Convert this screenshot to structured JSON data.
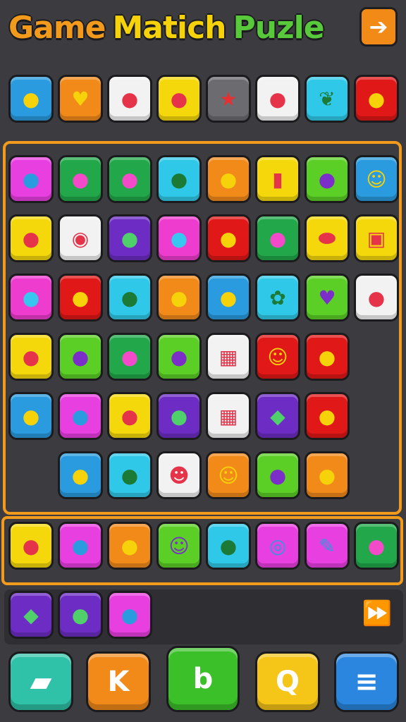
{
  "title": {
    "words": [
      "Game",
      "Matich",
      "Puzle"
    ],
    "colors": [
      "#f29a1c",
      "#f5d20a",
      "#58c93a"
    ]
  },
  "tile_colors": {
    "blue": "#2a9bde",
    "orange": "#f28a1a",
    "white": "#f2f2f2",
    "yellow": "#f5d80c",
    "gray": "#6b6b70",
    "red": "#e01818",
    "cyan": "#30c8e8",
    "pink": "#ee3ccf",
    "green": "#22a84a",
    "lime": "#5ccf26",
    "purple": "#6d2cc4",
    "magenta": "#e83fe0",
    "teal": "#2ab8c8"
  },
  "top_row": [
    {
      "color": "blue",
      "icon": "tools-icon"
    },
    {
      "color": "orange",
      "icon": "heart-icon"
    },
    {
      "color": "white",
      "icon": "blob-creature-icon"
    },
    {
      "color": "yellow",
      "icon": "bread-icon"
    },
    {
      "color": "gray",
      "icon": "star-icon"
    },
    {
      "color": "white",
      "icon": "pepper-icon"
    },
    {
      "color": "cyan",
      "icon": "leaf-icon"
    },
    {
      "color": "red",
      "icon": "eggs-icon"
    }
  ],
  "board_rows": [
    [
      {
        "color": "magenta",
        "icon": "bunny-icon"
      },
      {
        "color": "green",
        "icon": "map-pin-icon"
      },
      {
        "color": "green",
        "icon": "fox-icon"
      },
      {
        "color": "cyan",
        "icon": "bomb-icon"
      },
      {
        "color": "orange",
        "icon": "sign-icon"
      },
      {
        "color": "yellow",
        "icon": "trash-can-icon"
      },
      {
        "color": "lime",
        "icon": "cat-icon"
      },
      {
        "color": "blue",
        "icon": "smiley-icon"
      }
    ],
    [
      {
        "color": "yellow",
        "icon": "tomato-icon"
      },
      {
        "color": "white",
        "icon": "donut-icon"
      },
      {
        "color": "purple",
        "icon": "paintbrush-icon"
      },
      {
        "color": "pink",
        "icon": "cat-face-icon"
      },
      {
        "color": "red",
        "icon": "devil-icon"
      },
      {
        "color": "green",
        "icon": "grape-icon"
      },
      {
        "color": "yellow",
        "icon": "egg-icon"
      },
      {
        "color": "yellow",
        "icon": "cart-icon"
      }
    ],
    [
      {
        "color": "pink",
        "icon": "eggplant-icon"
      },
      {
        "color": "red",
        "icon": "pig-icon"
      },
      {
        "color": "cyan",
        "icon": "pig-face-icon"
      },
      {
        "color": "orange",
        "icon": "shield-face-icon"
      },
      {
        "color": "blue",
        "icon": "lollipop-icon"
      },
      {
        "color": "cyan",
        "icon": "flower-icon"
      },
      {
        "color": "lime",
        "icon": "heart-balloon-icon"
      },
      {
        "color": "white",
        "icon": "rabbit-icon"
      }
    ],
    [
      {
        "color": "yellow",
        "icon": "potato-icon"
      },
      {
        "color": "lime",
        "icon": "milk-carton-icon"
      },
      {
        "color": "green",
        "icon": "pot-icon"
      },
      {
        "color": "lime",
        "icon": "plum-icon"
      },
      {
        "color": "white",
        "icon": "basket-icon"
      },
      {
        "color": "red",
        "icon": "chick-icon"
      },
      {
        "color": "red",
        "icon": "pill-icon"
      }
    ],
    [
      {
        "color": "blue",
        "icon": "jar-icon"
      },
      {
        "color": "magenta",
        "icon": "fish-icon"
      },
      {
        "color": "yellow",
        "icon": "apple-icon"
      },
      {
        "color": "purple",
        "icon": "balloon-icon"
      },
      {
        "color": "white",
        "icon": "crate-icon"
      },
      {
        "color": "purple",
        "icon": "gem-icon"
      },
      {
        "color": "red",
        "icon": "bean-icon"
      }
    ],
    [
      {
        "color": "blue",
        "icon": "crab-icon"
      },
      {
        "color": "cyan",
        "icon": "broccoli-icon"
      },
      {
        "color": "white",
        "icon": "ghost-icon"
      },
      {
        "color": "orange",
        "icon": "robot-icon"
      },
      {
        "color": "lime",
        "icon": "lemon-icon"
      },
      {
        "color": "orange",
        "icon": "pickle-icon"
      }
    ]
  ],
  "tray_row": [
    {
      "color": "yellow",
      "icon": "candy-apple-icon"
    },
    {
      "color": "magenta",
      "icon": "chili-icon"
    },
    {
      "color": "orange",
      "icon": "watermelon-icon"
    },
    {
      "color": "lime",
      "icon": "smile-icon"
    },
    {
      "color": "cyan",
      "icon": "juice-box-icon"
    },
    {
      "color": "magenta",
      "icon": "spiral-icon"
    },
    {
      "color": "magenta",
      "icon": "pencil-icon"
    },
    {
      "color": "green",
      "icon": "balloon-yellow-icon"
    }
  ],
  "queue_row": [
    {
      "color": "purple",
      "icon": "drop-icon"
    },
    {
      "color": "purple",
      "icon": "ruler-pen-icon"
    },
    {
      "color": "magenta",
      "icon": "sweet-potato-icon"
    }
  ],
  "bottom_buttons": [
    {
      "name": "eraser-button",
      "color": "#2fc2a8",
      "icon": "eraser-icon"
    },
    {
      "name": "k-button",
      "color": "#f28a1a",
      "label": "K"
    },
    {
      "name": "undo-button",
      "color": "#3cc02a",
      "label": "b"
    },
    {
      "name": "q-button",
      "color": "#f5c518",
      "label": "Q"
    },
    {
      "name": "menu-button",
      "color": "#2a86de",
      "icon": "menu-icon"
    }
  ]
}
